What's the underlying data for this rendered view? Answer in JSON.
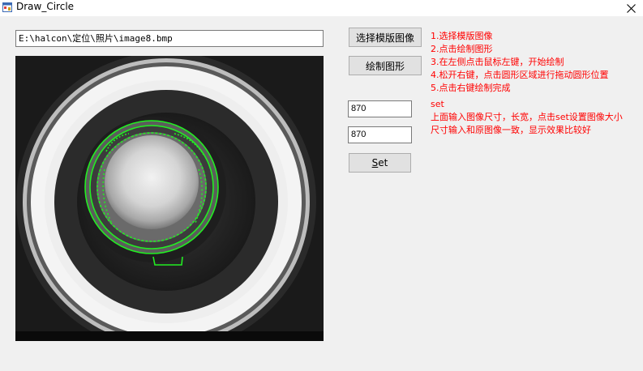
{
  "window": {
    "title": "Draw_Circle",
    "icon": "app-window-icon",
    "close_icon": "close-icon"
  },
  "path_field": {
    "value": "E:\\halcon\\定位\\照片\\image8.bmp"
  },
  "buttons": {
    "select_template": "选择模版图像",
    "draw_shape": "绘制图形",
    "set_prefix": "S",
    "set_suffix": "et"
  },
  "size_inputs": {
    "width": "870",
    "height": "870"
  },
  "instructions": {
    "step1": "1.选择模版图像",
    "step2": "2.点击绘制图形",
    "step3": "3.在左侧点击鼠标左键，开始绘制",
    "step4": "4.松开右键，点击圆形区域进行拖动圆形位置",
    "step5": "5.点击右键绘制完成",
    "set_title": "set",
    "set_line1": "上面输入图像尺寸，长宽，点击set设置图像大小",
    "set_line2": "尺寸输入和原图像一致，显示效果比较好"
  },
  "colors": {
    "instruction_text": "#ff0000",
    "overlay_green": "#22ee22",
    "window_bg": "#f0f0f0"
  }
}
